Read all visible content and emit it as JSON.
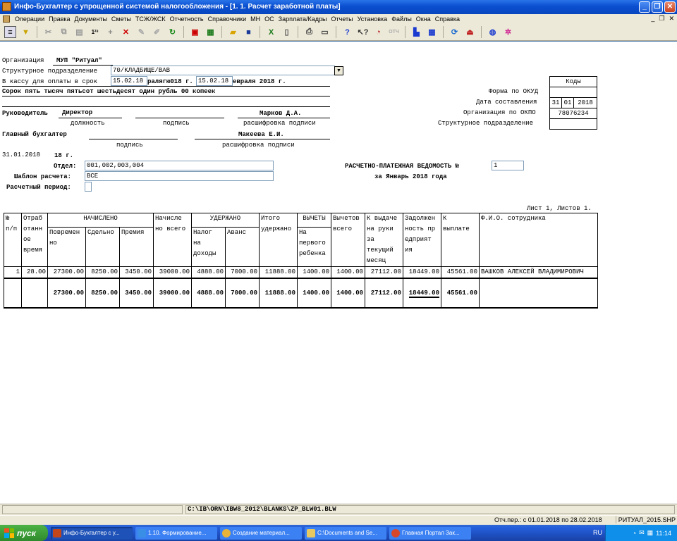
{
  "window": {
    "title": "Инфо-Бухгалтер с упрощенной системой налогообложения - [1. 1. Расчет заработной платы]",
    "minimize": "_",
    "restore": "❐",
    "close": "✕"
  },
  "menu": [
    "Операции",
    "Правка",
    "Документы",
    "Сметы",
    "ТСЖ/ЖСК",
    "Отчетность",
    "Справочники",
    "МН",
    "ОС",
    "Зарплата/Кадры",
    "Отчеты",
    "Установка",
    "Файлы",
    "Окна",
    "Справка"
  ],
  "mdi_controls": {
    "minimize": "_",
    "restore": "❐",
    "close": "✕"
  },
  "toolbar_icons": [
    "form-icon",
    "filter-icon",
    "cut-icon",
    "copy-icon",
    "paste-icon",
    "numbering-icon",
    "add-icon",
    "delete-icon",
    "mark-icon",
    "unmark-icon",
    "refresh-icon",
    "pdf-icon",
    "calculator-icon",
    "open-folder-icon",
    "save-icon",
    "excel-icon",
    "document-icon",
    "print-icon",
    "preview-icon",
    "help-icon",
    "context-help-icon",
    "clock-icon",
    "report-icon",
    "book-icon",
    "calendar-icon",
    "refresh-db-icon",
    "exit-icon",
    "network-icon",
    "settings-icon"
  ],
  "org": {
    "label": "Организация",
    "value": "МУП \"Ритуал\"",
    "dept_label": "Структурное подразделение",
    "dept_value": "70/КЛАДБИЩЕ/ВАВ",
    "dropdown_glyph": "▼",
    "cash_label": "В кассу для оплаты в срок",
    "cash_from": "15.02.18",
    "cash_mid": "ралягю018 г.",
    "cash_to": "15.02.18",
    "cash_tail": "евраля 2018 г.",
    "amount_words": "Сорок пять тысяч пятьсот шестьдесят один рубль 00 копеек"
  },
  "codes": {
    "header": "Коды",
    "rows": [
      {
        "label": "Форма по ОКУД",
        "value": ""
      },
      {
        "label": "Дата составления",
        "d": "31",
        "m": "01",
        "y": "2018"
      },
      {
        "label": "Организация по ОКПО",
        "value": "78076234"
      },
      {
        "label": "Структурное подразделение",
        "value": ""
      }
    ]
  },
  "signatures": {
    "head_label": "Руководитель",
    "head_position": "Директор",
    "head_name": "Марков Д.А.",
    "cap_position": "должность",
    "cap_sign": "подпись",
    "cap_decode": "расшифровка подписи",
    "chief_label": "Главный бухгалтер",
    "chief_name": "Макеева Е.И.",
    "cap_sign2": "подпись",
    "cap_decode2": "расшифровка подписи",
    "date_value": "31.01.2018",
    "date_suffix": "18 г."
  },
  "params": {
    "otdel_label": "Отдел:",
    "otdel_value": "001,002,003,004",
    "template_label": "Шаблон расчета:",
    "template_value": "ВСЕ",
    "period_label": "Расчетный период:",
    "statement_title": "РАСЧЕТНО-ПЛАТЕЖНАЯ ВЕДОМОСТЬ №",
    "statement_no": "1",
    "statement_period": "за Январь 2018 года"
  },
  "sheet_info": "Лист 1, Листов 1.",
  "table": {
    "h_no": [
      "№",
      "п/п"
    ],
    "h_time": [
      "Отраб",
      "отанн",
      "ое",
      "время"
    ],
    "h_accrued": "НАЧИСЛЕНО",
    "h_povremen": [
      "Повремен",
      "но"
    ],
    "h_sdelno": "Сдельно",
    "h_premia": "Премия",
    "h_total_acc": [
      "Начисле",
      "но всего"
    ],
    "h_withheld": "УДЕРЖАНО",
    "h_tax": [
      "Налог",
      "на",
      "доходы"
    ],
    "h_avans": "Аванс",
    "h_total_wh": [
      "Итого",
      "удержано"
    ],
    "h_deductions": "ВЫЧЕТЫ",
    "h_first_child": [
      "На",
      "первого",
      "ребенка"
    ],
    "h_ded_total": [
      "Вычетов",
      "всего"
    ],
    "h_to_pay_hand": [
      "К выдаче",
      "на руки",
      "за",
      "текущий",
      "месяц"
    ],
    "h_debt": [
      "Задолжен",
      "ность пр",
      "едприят",
      "ия"
    ],
    "h_to_pay": [
      "К",
      "выплате"
    ],
    "h_fio": "Ф.И.О. сотрудника",
    "rows": [
      {
        "no": "1",
        "time": "28.00",
        "povremen": "27300.00",
        "sdelno": "8250.00",
        "premia": "3450.00",
        "total_acc": "39000.00",
        "tax": "4888.00",
        "avans": "7000.00",
        "total_wh": "11888.00",
        "first_child": "1400.00",
        "ded_total": "1400.00",
        "to_pay_hand": "27112.00",
        "debt": "18449.00",
        "to_pay": "45561.00",
        "fio": "ВАШКОВ АЛЕКСЕЙ ВЛАДИМИРОВИЧ"
      }
    ],
    "totals": {
      "povremen": "27300.00",
      "sdelno": "8250.00",
      "premia": "3450.00",
      "total_acc": "39000.00",
      "tax": "4888.00",
      "avans": "7000.00",
      "total_wh": "11888.00",
      "first_child": "1400.00",
      "ded_total": "1400.00",
      "to_pay_hand": "27112.00",
      "debt": "18449.00",
      "to_pay": "45561.00"
    }
  },
  "status": {
    "path": "C:\\IB\\ORN\\IBW8_2012\\BLANKS\\ZP_BLW01.BLW",
    "period": "Отч.пер.: с 01.01.2018 по 28.02.2018",
    "file": "РИТУАЛ_2015.SHP"
  },
  "taskbar": {
    "start": "пуск",
    "tasks": [
      {
        "label": "Инфо-Бухгалтер с у...",
        "color": "#c2461a"
      },
      {
        "label": "1.10. Формирование...",
        "color": "#3a8ee6"
      },
      {
        "label": "Создание материал...",
        "color": "#e8b339"
      },
      {
        "label": "C:\\Documents and Se...",
        "color": "#e8c860"
      },
      {
        "label": "Главная Портал Зак...",
        "color": "#d9472b"
      }
    ],
    "lang": "RU",
    "clock": "11:14"
  }
}
